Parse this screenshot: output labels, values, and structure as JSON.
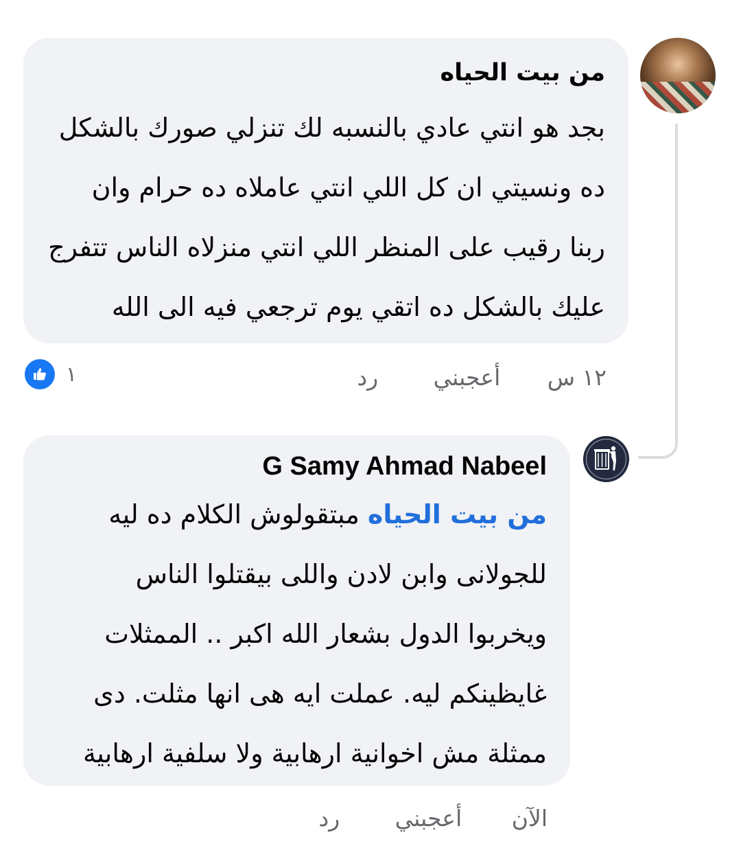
{
  "comments": [
    {
      "author": "من بيت الحياه",
      "lines": [
        "بجد هو انتي عادي بالنسبه لك تنزلي صورك بالشكل",
        "ده ونسيتي ان كل اللي انتي عاملاه ده حرام وان",
        "ربنا رقيب على المنظر اللي انتي منزلاه الناس تتفرج",
        "عليك بالشكل ده اتقي يوم ترجعي فيه الى الله"
      ],
      "time": "١٢ س",
      "like_label": "أعجبني",
      "reply_label": "رد",
      "reaction_count": "١"
    },
    {
      "author": "G Samy Ahmad Nabeel",
      "mention": "من بيت الحياه",
      "first_line_rest": "مبتقولوش الكلام ده ليه",
      "lines": [
        "للجولانى وابن لادن واللى بيقتلوا الناس",
        "ويخربوا الدول بشعار الله اكبر .. الممثلات",
        "غايظينكم ليه. عملت ايه هى انها مثلت. دى",
        "ممثلة مش اخوانية ارهابية ولا سلفية ارهابية"
      ],
      "time": "الآن",
      "like_label": "أعجبني",
      "reply_label": "رد"
    }
  ],
  "colors": {
    "bubble": "#f0f2f5",
    "mention": "#216fdb",
    "meta": "#65676b",
    "like_badge": "#1877f2"
  },
  "icons": {
    "reaction": "thumbs-up-icon",
    "avatar2": "trash-bin-icon"
  }
}
